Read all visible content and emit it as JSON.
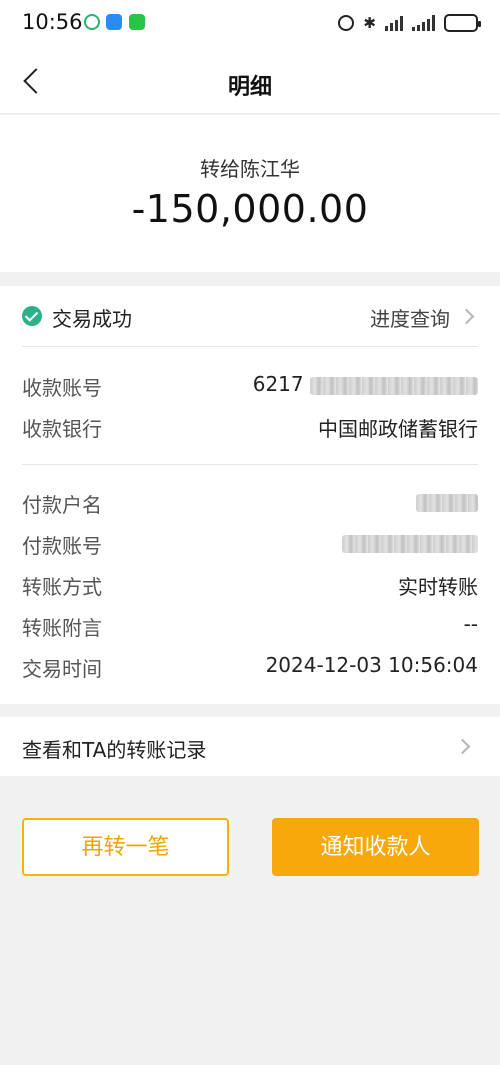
{
  "status_bar": {
    "time": "10:56",
    "icons": [
      "app-notification-icon",
      "message-icon",
      "wechat-icon",
      "alarm-icon",
      "bluetooth-icon",
      "signal-icon",
      "signal-icon",
      "battery-icon"
    ],
    "battery_level": 0.8
  },
  "nav": {
    "title": "明细",
    "back_icon": "back-arrow-icon"
  },
  "summary": {
    "recipient_line": "转给陈江华",
    "amount": "-150,000.00"
  },
  "status": {
    "text": "交易成功",
    "progress_link": "进度查询",
    "color": "#2bb28b"
  },
  "payee": {
    "account_label": "收款账号",
    "account_prefix": "6217",
    "bank_label": "收款银行",
    "bank_value": "中国邮政储蓄银行"
  },
  "payer": {
    "name_label": "付款户名",
    "account_label": "付款账号",
    "method_label": "转账方式",
    "method_value": "实时转账",
    "note_label": "转账附言",
    "note_value": "--",
    "time_label": "交易时间",
    "time_value": "2024-12-03 10:56:04"
  },
  "history": {
    "label": "查看和TA的转账记录"
  },
  "actions": {
    "again_label": "再转一笔",
    "notify_label": "通知收款人",
    "accent_color": "#f7a80a"
  }
}
